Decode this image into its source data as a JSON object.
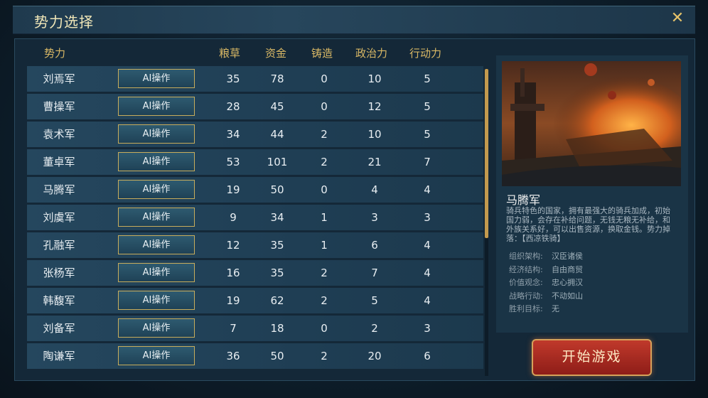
{
  "window": {
    "title": "势力选择"
  },
  "table": {
    "headers": [
      "势力",
      "粮草",
      "资金",
      "铸造",
      "政治力",
      "行动力"
    ],
    "ai_label": "AI操作",
    "rows": [
      {
        "name": "刘焉军",
        "grain": "35",
        "money": "78",
        "forge": "0",
        "politics": "10",
        "action": "5"
      },
      {
        "name": "曹操军",
        "grain": "28",
        "money": "45",
        "forge": "0",
        "politics": "12",
        "action": "5"
      },
      {
        "name": "袁术军",
        "grain": "34",
        "money": "44",
        "forge": "2",
        "politics": "10",
        "action": "5"
      },
      {
        "name": "董卓军",
        "grain": "53",
        "money": "101",
        "forge": "2",
        "politics": "21",
        "action": "7"
      },
      {
        "name": "马腾军",
        "grain": "19",
        "money": "50",
        "forge": "0",
        "politics": "4",
        "action": "4"
      },
      {
        "name": "刘虞军",
        "grain": "9",
        "money": "34",
        "forge": "1",
        "politics": "3",
        "action": "3"
      },
      {
        "name": "孔融军",
        "grain": "12",
        "money": "35",
        "forge": "1",
        "politics": "6",
        "action": "4"
      },
      {
        "name": "张杨军",
        "grain": "16",
        "money": "35",
        "forge": "2",
        "politics": "7",
        "action": "4"
      },
      {
        "name": "韩馥军",
        "grain": "19",
        "money": "62",
        "forge": "2",
        "politics": "5",
        "action": "4"
      },
      {
        "name": "刘备军",
        "grain": "7",
        "money": "18",
        "forge": "0",
        "politics": "2",
        "action": "3"
      },
      {
        "name": "陶谦军",
        "grain": "36",
        "money": "50",
        "forge": "2",
        "politics": "20",
        "action": "6"
      }
    ]
  },
  "detail": {
    "name": "马腾军",
    "description": "骑兵特色的国家，拥有最强大的骑兵加成，初始国力弱，会存在补给问题，无钱无粮无补给，和外族关系好，可以出售资源，换取金钱。势力掉落：【西凉铁骑】",
    "attributes": [
      {
        "label": "组织架构:",
        "value": "汉臣诸侯"
      },
      {
        "label": "经济结构:",
        "value": "自由商贸"
      },
      {
        "label": "价值观念:",
        "value": "忠心拥汉"
      },
      {
        "label": "战略行动:",
        "value": "不动如山"
      },
      {
        "label": "胜利目标:",
        "value": "无"
      }
    ]
  },
  "start_button": "开始游戏",
  "scroll_fraction": 0.55,
  "colors": {
    "accent_gold": "#d9b865",
    "start_red": "#c0392b"
  }
}
